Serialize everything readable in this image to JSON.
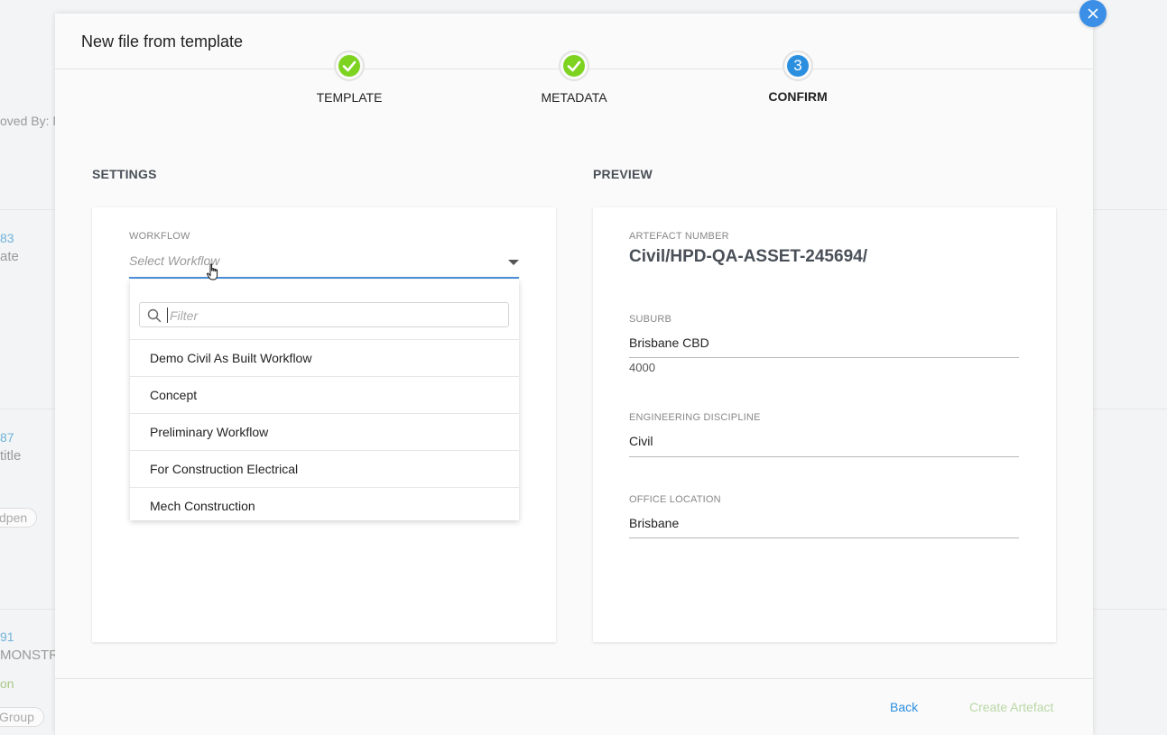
{
  "background": {
    "approved_by": "oved By: N",
    "row1_num": "83",
    "row1_text": "ate",
    "row2_num": "87",
    "row2_text": "title",
    "row2_pill": "dpen",
    "row3_num": "91",
    "row3_text": "MONSTR",
    "row3_status": "on",
    "row3_pill": "Group"
  },
  "modal": {
    "title": "New file from template",
    "close_icon": "close-icon"
  },
  "stepper": {
    "steps": [
      {
        "label": "TEMPLATE",
        "state": "done",
        "icon": "check-icon"
      },
      {
        "label": "METADATA",
        "state": "done",
        "icon": "check-icon"
      },
      {
        "label": "CONFIRM",
        "state": "active",
        "number": "3"
      }
    ]
  },
  "settings": {
    "heading": "SETTINGS",
    "workflow_label": "WORKFLOW",
    "workflow_value": "Select Workflow",
    "filter_placeholder": "Filter",
    "options": [
      "Demo Civil As Built Workflow",
      "Concept",
      "Preliminary Workflow",
      "For Construction Electrical",
      "Mech Construction"
    ]
  },
  "preview": {
    "heading": "PREVIEW",
    "artefact_number_label": "ARTEFACT NUMBER",
    "artefact_number": "Civil/HPD-QA-ASSET-245694/",
    "suburb_label": "SUBURB",
    "suburb_value": "Brisbane CBD",
    "suburb_postcode": "4000",
    "discipline_label": "ENGINEERING DISCIPLINE",
    "discipline_value": "Civil",
    "office_label": "OFFICE LOCATION",
    "office_value": "Brisbane"
  },
  "footer": {
    "back_label": "Back",
    "create_label": "Create Artefact"
  },
  "colors": {
    "accent": "#2b8fe0",
    "done": "#7ed321",
    "disabled_button": "#b9d8a6"
  }
}
